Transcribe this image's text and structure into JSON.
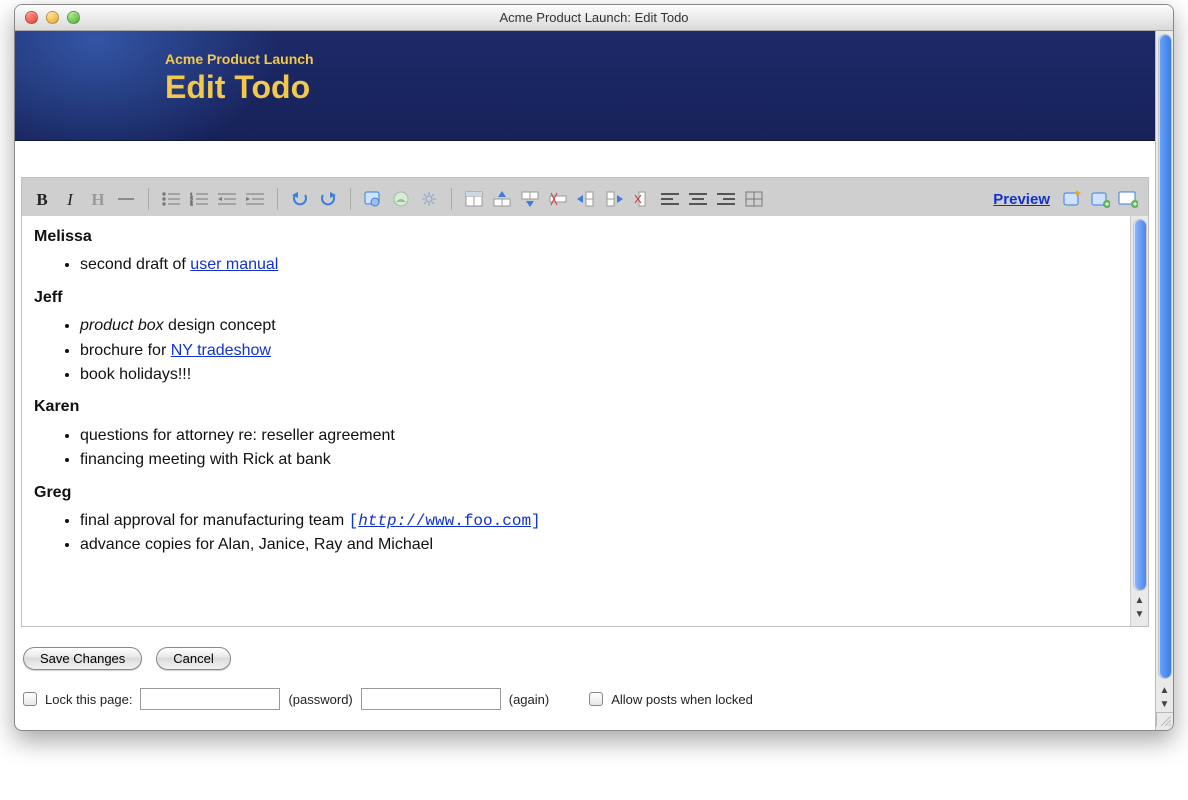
{
  "window": {
    "title": "Acme Product Launch: Edit Todo"
  },
  "banner": {
    "supertitle": "Acme Product Launch",
    "title": "Edit Todo"
  },
  "toolbar": {
    "bold": "B",
    "italic": "I",
    "heading": "H",
    "preview_label": "Preview"
  },
  "content": {
    "sections": [
      {
        "name": "Melissa",
        "items": [
          {
            "pre": "second draft of ",
            "link": "user manual"
          }
        ]
      },
      {
        "name": "Jeff",
        "items": [
          {
            "emph": "product box",
            "post": " design concept"
          },
          {
            "pre": "brochure for ",
            "link": "NY tradeshow"
          },
          {
            "text": "book holidays!!!"
          }
        ]
      },
      {
        "name": "Karen",
        "items": [
          {
            "text": "questions for attorney re: reseller agreement"
          },
          {
            "text": "financing meeting with Rick at bank"
          }
        ]
      },
      {
        "name": "Greg",
        "items": [
          {
            "pre": "final approval for manufacturing team ",
            "bracket_url": {
              "proto_pre": "http:",
              "rest": "//www.foo.com"
            }
          },
          {
            "text": "advance copies for Alan, Janice, Ray and Michael"
          }
        ]
      }
    ]
  },
  "actions": {
    "save": "Save Changes",
    "cancel": "Cancel"
  },
  "lock": {
    "label": "Lock this page:",
    "hint1": "(password)",
    "hint2": "(again)",
    "allow_posts": "Allow posts when locked"
  }
}
